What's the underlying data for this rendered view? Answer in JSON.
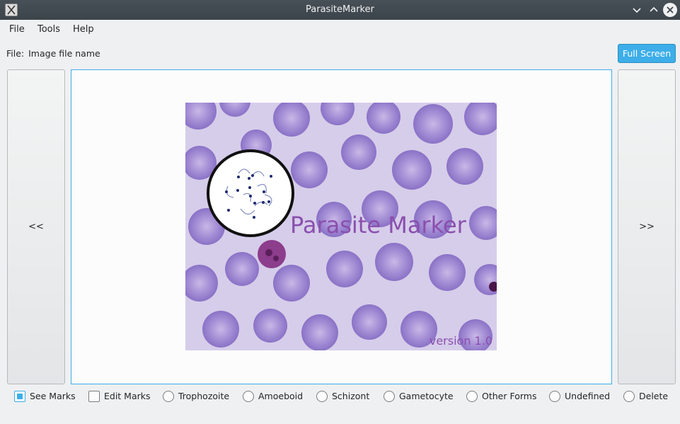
{
  "window": {
    "title": "ParasiteMarker"
  },
  "menu": {
    "items": [
      "File",
      "Tools",
      "Help"
    ]
  },
  "file_info": {
    "label": "File:",
    "value": "Image file name"
  },
  "buttons": {
    "full_screen": "Full Screen",
    "prev": "<<",
    "next": ">>"
  },
  "splash": {
    "title": "Parasite Marker",
    "version": "version 1.0"
  },
  "options": [
    {
      "label": "See Marks",
      "type": "checkbox",
      "checked": true
    },
    {
      "label": "Edit Marks",
      "type": "checkbox",
      "checked": false
    },
    {
      "label": "Trophozoite",
      "type": "radio",
      "checked": false
    },
    {
      "label": "Amoeboid",
      "type": "radio",
      "checked": false
    },
    {
      "label": "Schizont",
      "type": "radio",
      "checked": false
    },
    {
      "label": "Gametocyte",
      "type": "radio",
      "checked": false
    },
    {
      "label": "Other Forms",
      "type": "radio",
      "checked": false
    },
    {
      "label": "Undefined",
      "type": "radio",
      "checked": false
    },
    {
      "label": "Delete",
      "type": "radio",
      "checked": false
    }
  ],
  "colors": {
    "accent": "#3daee9",
    "titlebar": "#475057",
    "splash_text": "#8a4fae"
  }
}
